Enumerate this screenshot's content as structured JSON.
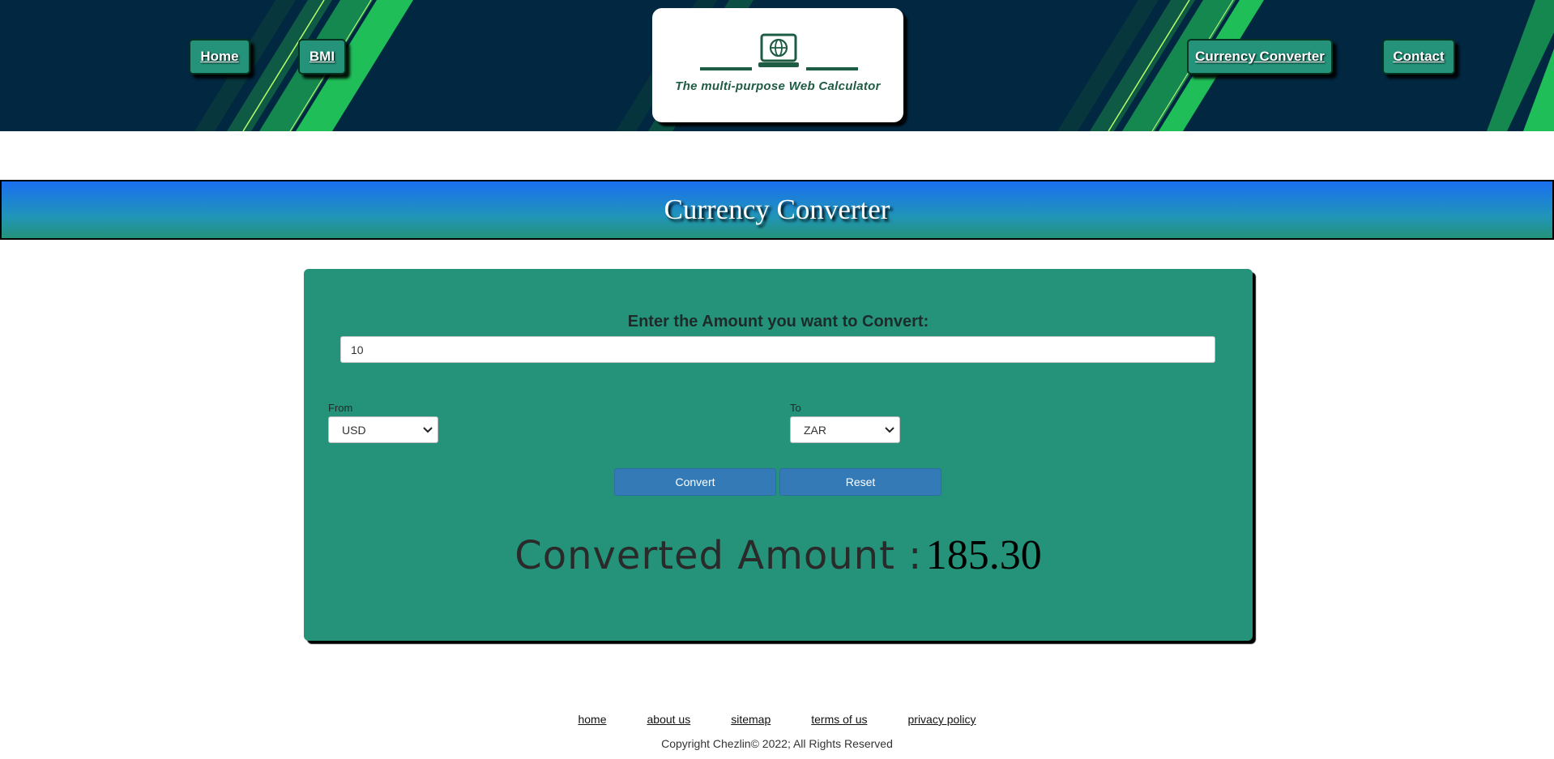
{
  "colors": {
    "header_bg": "#022741",
    "nav_button": "#24937a",
    "card_bg": "#24937a",
    "action_button": "#337ab7",
    "banner_top": "#1a6ff0",
    "logo_green": "#1f5c44"
  },
  "nav": {
    "home": "Home",
    "bmi": "BMI",
    "currency_converter": "Currency Converter",
    "contact": "Contact"
  },
  "logo": {
    "icon": "laptop-globe-icon",
    "title": "The multi-purpose Web Calculator"
  },
  "page_title": "Currency Converter",
  "converter": {
    "amount_label": "Enter the Amount you want to Convert:",
    "amount_value": "10",
    "from_label": "From",
    "from_value": "USD",
    "to_label": "To",
    "to_value": "ZAR",
    "convert_label": "Convert",
    "reset_label": "Reset",
    "result_label": "Converted Amount :",
    "result_value": "185.30"
  },
  "footer": {
    "links": [
      "home",
      "about us",
      "sitemap",
      "terms of us",
      "privacy policy"
    ],
    "copyright": "Copyright Chezlin© 2022; All Rights Reserved"
  }
}
